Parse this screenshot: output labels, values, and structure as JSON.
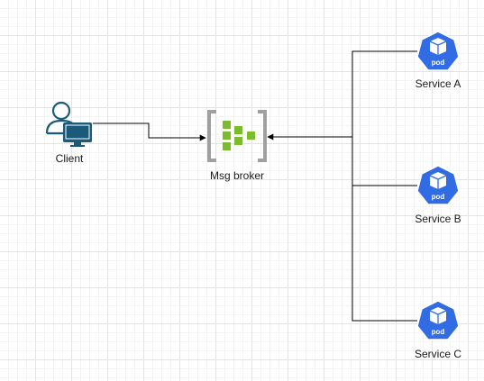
{
  "nodes": {
    "client": {
      "label": "Client",
      "icon": "user-computer-icon"
    },
    "broker": {
      "label": "Msg broker",
      "icon": "message-broker-icon"
    },
    "services": [
      {
        "label": "Service A",
        "icon": "kubernetes-pod-icon",
        "badge": "pod"
      },
      {
        "label": "Service B",
        "icon": "kubernetes-pod-icon",
        "badge": "pod"
      },
      {
        "label": "Service C",
        "icon": "kubernetes-pod-icon",
        "badge": "pod"
      }
    ]
  },
  "colors": {
    "user_icon": "#1b5a78",
    "broker_frame": "#a0a0a0",
    "broker_blocks": "#7dbb2e",
    "pod_fill": "#326ce5",
    "edge": "#000000"
  }
}
